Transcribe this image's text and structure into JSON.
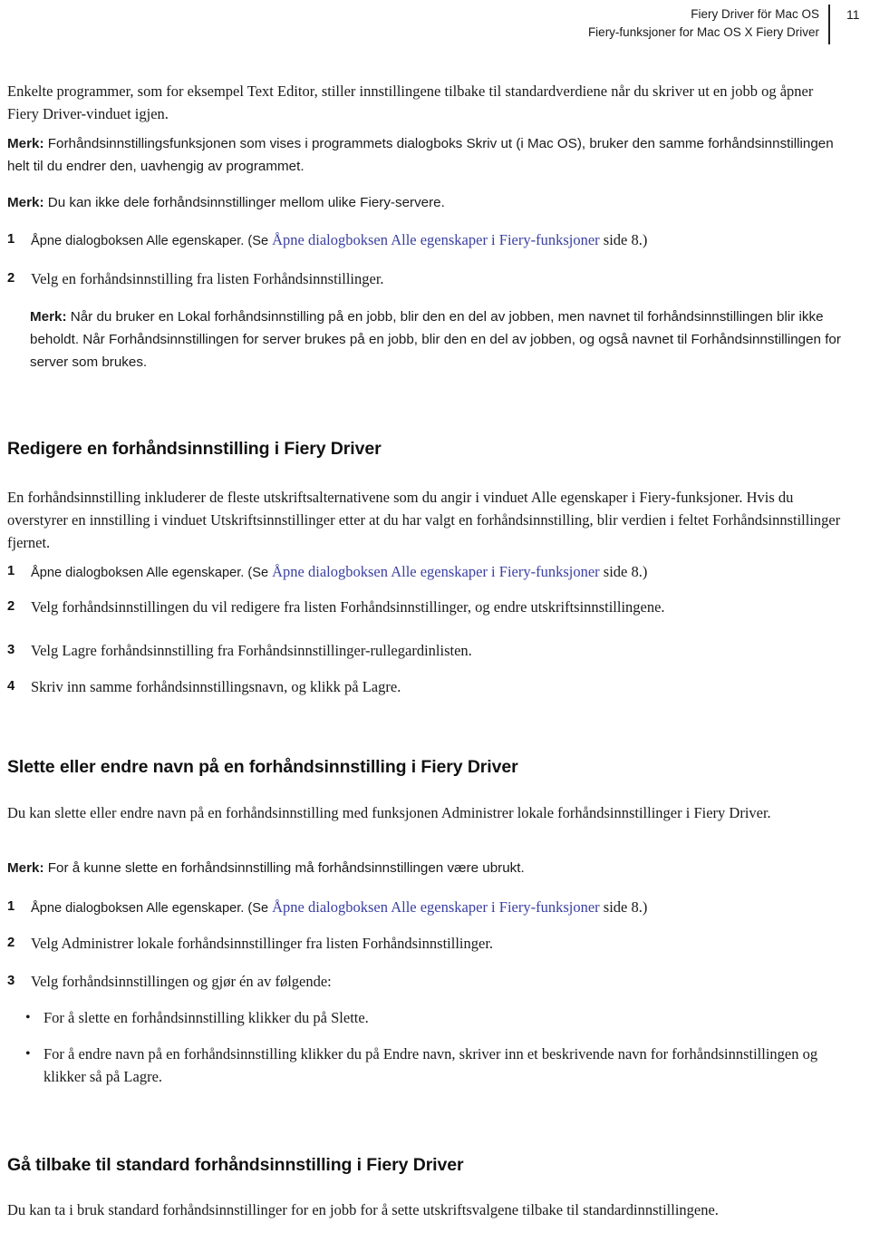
{
  "header": {
    "title_line1": "Fiery Driver för Mac OS",
    "title_line2": "Fiery-funksjoner for Mac OS X Fiery Driver",
    "page_number": "11",
    "divider_color": "#231f20"
  },
  "colors": {
    "text": "#1a1a1a",
    "link": "#3a3fa0",
    "heading": "#111111",
    "background": "#ffffff"
  },
  "body": {
    "intro_paragraph": "Enkelte programmer, som for eksempel Text Editor, stiller innstillingene tilbake til standardverdiene når du skriver ut en jobb og åpner Fiery Driver-vinduet igjen.",
    "note1_label": "Merk:",
    "note1_text": "Forhåndsinnstillingsfunksjonen som vises i programmets dialogboks Skriv ut (i Mac OS), bruker den samme forhåndsinnstillingen helt til du endrer den, uavhengig av programmet.",
    "note2_label": "Merk:",
    "note2_text": "Du kan ikke dele forhåndsinnstillinger mellom ulike Fiery-servere.",
    "step1_num": "1",
    "step1_pre": "Åpne dialogboksen Alle egenskaper. (Se ",
    "step1_link": "Åpne dialogboksen Alle egenskaper i Fiery-funksjoner",
    "step1_post": " side 8.)",
    "step2_num": "2",
    "step2_text": "Velg en forhåndsinnstilling fra listen Forhåndsinnstillinger.",
    "note3_label": "Merk:",
    "note3_text": "Når du bruker en Lokal forhåndsinnstilling på en jobb, blir den en del av jobben, men navnet til forhåndsinnstillingen blir ikke beholdt. Når Forhåndsinnstillingen for server brukes på en jobb, blir den en del av jobben, og også navnet til Forhåndsinnstillingen for server som brukes."
  },
  "section_edit": {
    "heading": "Redigere en forhåndsinnstilling i Fiery Driver",
    "paragraph": "En forhåndsinnstilling inkluderer de fleste utskriftsalternativene som du angir i vinduet Alle egenskaper i Fiery-funksjoner. Hvis du overstyrer en innstilling i vinduet Utskriftsinnstillinger etter at du har valgt en forhåndsinnstilling, blir verdien i feltet Forhåndsinnstillinger fjernet.",
    "step1_num": "1",
    "step1_pre": "Åpne dialogboksen Alle egenskaper. (Se ",
    "step1_link": "Åpne dialogboksen Alle egenskaper i Fiery-funksjoner",
    "step1_post": " side 8.)",
    "step2_num": "2",
    "step2_text": "Velg forhåndsinnstillingen du vil redigere fra listen Forhåndsinnstillinger, og endre utskriftsinnstillingene.",
    "step3_num": "3",
    "step3_text": "Velg Lagre forhåndsinnstilling fra Forhåndsinnstillinger-rullegardinlisten.",
    "step4_num": "4",
    "step4_text": "Skriv inn samme forhåndsinnstillingsnavn, og klikk på Lagre."
  },
  "section_delete": {
    "heading": "Slette eller endre navn på en forhåndsinnstilling i Fiery Driver",
    "paragraph": "Du kan slette eller endre navn på en forhåndsinnstilling med funksjonen Administrer lokale forhåndsinnstillinger i Fiery Driver.",
    "note_label": "Merk:",
    "note_text": "For å kunne slette en forhåndsinnstilling må forhåndsinnstillingen være ubrukt.",
    "step1_num": "1",
    "step1_pre": "Åpne dialogboksen Alle egenskaper. (Se ",
    "step1_link": "Åpne dialogboksen Alle egenskaper i Fiery-funksjoner",
    "step1_post": " side 8.)",
    "step2_num": "2",
    "step2_text": "Velg Administrer lokale forhåndsinnstillinger fra listen Forhåndsinnstillinger.",
    "step3_num": "3",
    "step3_text": "Velg forhåndsinnstillingen og gjør én av følgende:",
    "bullet_marker": "•",
    "bullet1_text": "For å slette en forhåndsinnstilling klikker du på Slette.",
    "bullet2_text": "For å endre navn på en forhåndsinnstilling klikker du på Endre navn, skriver inn et beskrivende navn for forhåndsinnstillingen og klikker så på Lagre."
  },
  "section_default": {
    "heading": "Gå tilbake til standard forhåndsinnstilling i Fiery Driver",
    "paragraph": "Du kan ta i bruk standard forhåndsinnstillinger for en jobb for å sette utskriftsvalgene tilbake til standardinnstillingene."
  }
}
